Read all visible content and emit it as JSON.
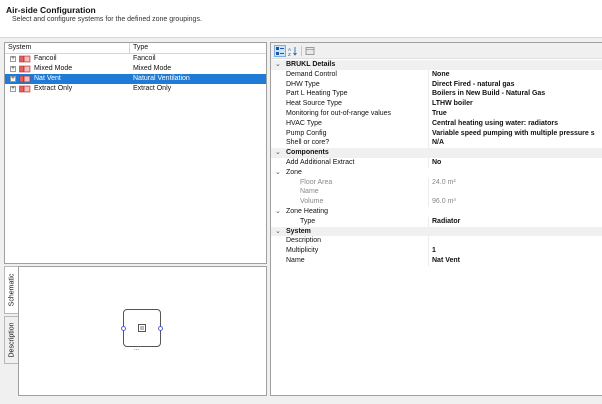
{
  "header": {
    "title": "Air-side Configuration",
    "subtitle": "Select and configure systems for the defined zone groupings."
  },
  "tree": {
    "col_system": "System",
    "col_type": "Type",
    "items": [
      {
        "name": "Fancoil",
        "type": "Fancoil"
      },
      {
        "name": "Mixed Mode",
        "type": "Mixed Mode"
      },
      {
        "name": "Nat Vent",
        "type": "Natural Ventilation"
      },
      {
        "name": "Extract Only",
        "type": "Extract Only"
      }
    ]
  },
  "tabs": {
    "schematic": "Schematic",
    "description": "Description"
  },
  "schematic": {
    "dots": "..."
  },
  "props": {
    "brukl": {
      "label": "BRUKL Details",
      "demand_control": {
        "label": "Demand Control",
        "value": "None"
      },
      "dhw_type": {
        "label": "DHW Type",
        "value": "Direct Fired - natural gas"
      },
      "part_l": {
        "label": "Part L Heating Type",
        "value": "Boilers in New Build - Natural Gas"
      },
      "heat_source": {
        "label": "Heat Source Type",
        "value": "LTHW boiler"
      },
      "monitoring": {
        "label": "Monitoring for out-of-range values",
        "value": "True"
      },
      "hvac": {
        "label": "HVAC Type",
        "value": "Central heating using water: radiators"
      },
      "pump": {
        "label": "Pump Config",
        "value": "Variable speed pumping with multiple pressure s"
      },
      "shell": {
        "label": "Shell or core?",
        "value": "N/A"
      }
    },
    "components": {
      "label": "Components",
      "add_extract": {
        "label": "Add Additional Extract",
        "value": "No"
      },
      "zone": {
        "label": "Zone"
      },
      "floor_area": {
        "label": "Floor Area",
        "value": "24.0 m²"
      },
      "name": {
        "label": "Name",
        "value": ""
      },
      "volume": {
        "label": "Volume",
        "value": "96.0 m³"
      },
      "zone_heating": {
        "label": "Zone Heating"
      },
      "type": {
        "label": "Type",
        "value": "Radiator"
      }
    },
    "system": {
      "label": "System",
      "description": {
        "label": "Description",
        "value": ""
      },
      "multiplicity": {
        "label": "Multiplicity",
        "value": "1"
      },
      "name": {
        "label": "Name",
        "value": "Nat Vent"
      }
    }
  }
}
